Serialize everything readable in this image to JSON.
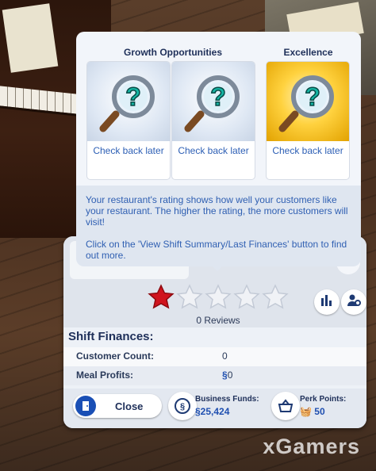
{
  "tooltip": {
    "growth_title": "Growth Opportunities",
    "excellence_title": "Excellence",
    "cards": [
      {
        "label": "Check back later",
        "style": "blue"
      },
      {
        "label": "Check back later",
        "style": "blue"
      },
      {
        "label": "Check back later",
        "style": "gold"
      }
    ],
    "description": "Your restaurant's rating shows how well your customers like your restaurant. The higher the rating, the more customers will visit!",
    "instruction": "Click on the 'View Shift Summary/Last Finances' button to find out more."
  },
  "rating": {
    "stars_filled": 1,
    "stars_total": 5,
    "reviews_text": "0 Reviews"
  },
  "finances": {
    "header": "Shift Finances:",
    "customer_count_label": "Customer Count:",
    "customer_count_value": "0",
    "meal_profits_label": "Meal Profits:",
    "meal_profits_value": "0",
    "currency_symbol": "§"
  },
  "footer": {
    "close_label": "Close",
    "business_funds_label": "Business Funds:",
    "business_funds_value": "§25,424",
    "perk_points_label": "Perk Points:",
    "perk_points_value": "50"
  },
  "watermark": "xGamers",
  "colors": {
    "star_filled": "#d0141e",
    "accent_blue": "#2d5fb5",
    "header_navy": "#1e2f59"
  }
}
